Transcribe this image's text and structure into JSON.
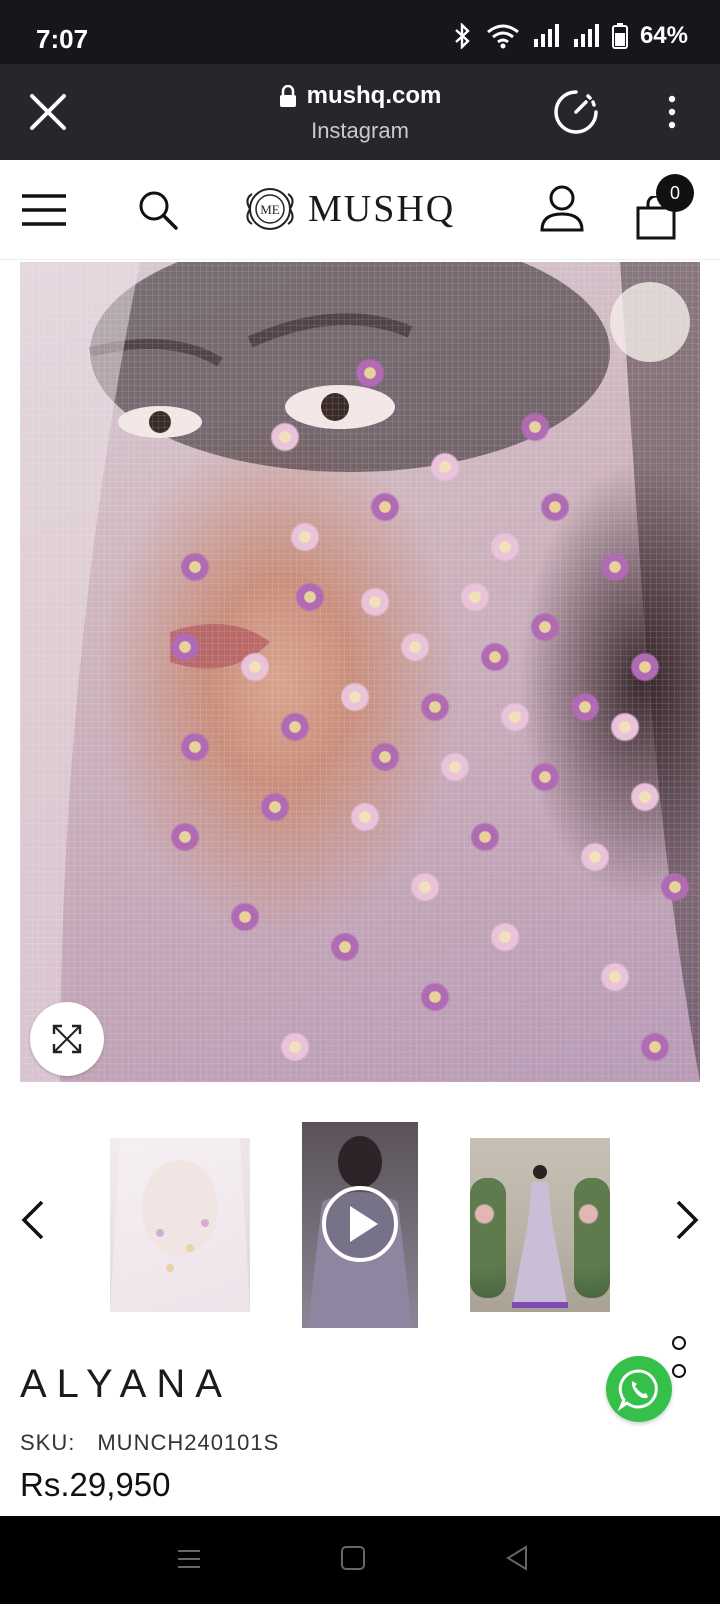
{
  "status_bar": {
    "time": "7:07",
    "battery": "64%",
    "icons": [
      "bluetooth-icon",
      "wifi-icon",
      "signal-icon",
      "signal-icon",
      "battery-icon"
    ]
  },
  "browser": {
    "domain": "mushq.com",
    "source_label": "Instagram",
    "icons": [
      "close-icon",
      "lock-icon",
      "speed-icon",
      "more-vert-icon"
    ]
  },
  "site_header": {
    "logo_text": "MUSHQ",
    "logo_emblem_text": "ME",
    "cart_count": "0",
    "icons": [
      "menu-icon",
      "search-icon",
      "account-icon",
      "cart-icon"
    ]
  },
  "gallery": {
    "thumbnails": [
      {
        "kind": "image",
        "state": "inactive"
      },
      {
        "kind": "video",
        "icon": "play-icon"
      },
      {
        "kind": "image",
        "state": "active"
      }
    ]
  },
  "product": {
    "title": "ALYANA",
    "sku_label": "SKU:",
    "sku_value": "MUNCH240101S",
    "price": "Rs.29,950"
  },
  "colors": {
    "status_bg": "#15171c",
    "browser_bg": "#25272b",
    "whatsapp": "#35c04a"
  }
}
